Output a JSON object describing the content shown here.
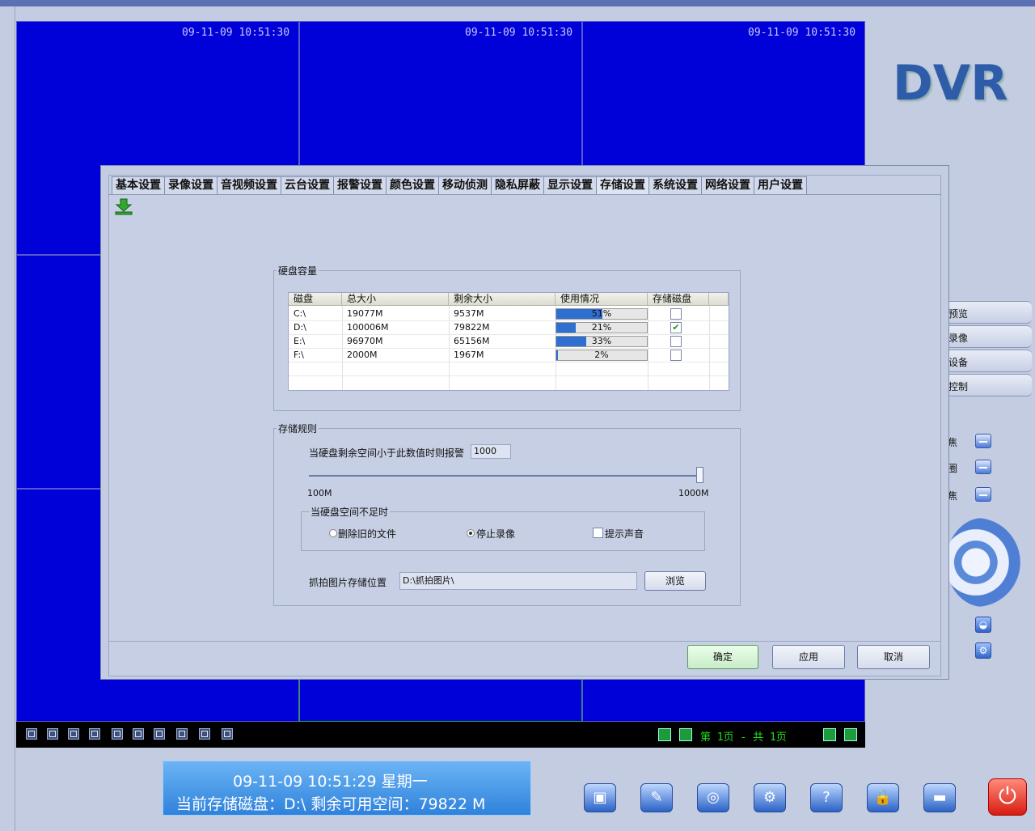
{
  "video": {
    "timestamps": [
      "09-11-09 10:51:30",
      "09-11-09 10:51:30",
      "09-11-09 10:51:30"
    ]
  },
  "logo": "DVR",
  "right_nav": [
    "预览",
    "录像",
    "设备",
    "控制"
  ],
  "right_side_items": [
    "焦",
    "圈",
    "焦"
  ],
  "tabs": [
    "基本设置",
    "录像设置",
    "音视频设置",
    "云台设置",
    "报警设置",
    "颜色设置",
    "移动侦测",
    "隐私屏蔽",
    "显示设置",
    "存储设置",
    "系统设置",
    "网络设置",
    "用户设置"
  ],
  "active_tab": "存储设置",
  "disk_group": {
    "title": "硬盘容量",
    "headers": [
      "磁盘",
      "总大小",
      "剩余大小",
      "使用情况",
      "存储磁盘"
    ],
    "rows": [
      {
        "disk": "C:\\",
        "total": "19077M",
        "free": "9537M",
        "usage": 51,
        "usage_label": "51%",
        "checked": false
      },
      {
        "disk": "D:\\",
        "total": "100006M",
        "free": "79822M",
        "usage": 21,
        "usage_label": "21%",
        "checked": true
      },
      {
        "disk": "E:\\",
        "total": "96970M",
        "free": "65156M",
        "usage": 33,
        "usage_label": "33%",
        "checked": false
      },
      {
        "disk": "F:\\",
        "total": "2000M",
        "free": "1967M",
        "usage": 2,
        "usage_label": "2%",
        "checked": false
      }
    ]
  },
  "rule_group": {
    "title": "存储规则",
    "alarm_label": "当硬盘剩余空间小于此数值时则报警",
    "alarm_value": "1000",
    "slider_min": "100M",
    "slider_max": "1000M",
    "slider_level": 1.0,
    "insufficient_title": "当硬盘空间不足时",
    "option_delete": "删除旧的文件",
    "option_stop": "停止录像",
    "option_sound": "提示声音",
    "selected_option": "停止录像",
    "snapshot_label": "抓拍图片存储位置",
    "snapshot_path": "D:\\抓拍图片\\",
    "browse": "浏览"
  },
  "buttons": {
    "ok": "确定",
    "apply": "应用",
    "cancel": "取消"
  },
  "pager": "第 1页 - 共 1页",
  "status": {
    "datetime": "09-11-09   10:51:29     星期一",
    "disk_info": "当前存储磁盘：D:\\     剩余可用空间：79822 M"
  },
  "colors": {
    "video_bg": "#0000d8",
    "accent": "#2f6fd0",
    "pager": "#22dd22"
  }
}
